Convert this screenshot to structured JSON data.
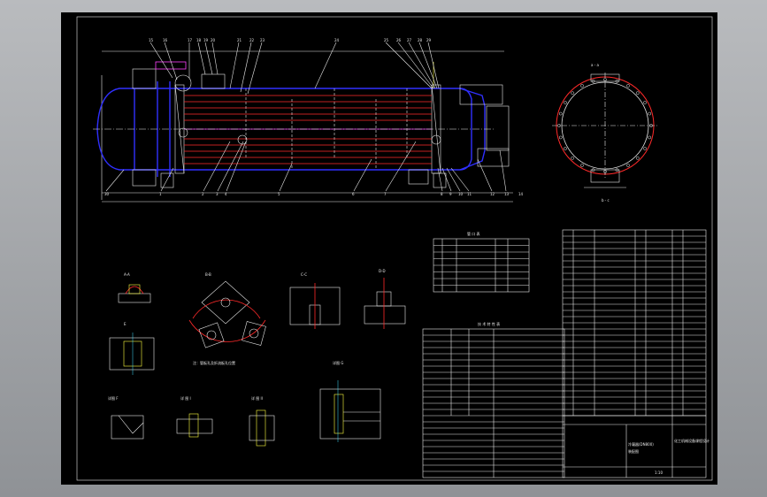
{
  "section_labels": {
    "nozzle_table": "管 口 表",
    "tech_spec": "技 术 特 性 表"
  },
  "views": {
    "side_view_label": "a - a",
    "top_label": "A - A",
    "detail_1": "详 图 I",
    "detail_2": "详 图 II"
  },
  "drawing_title": {
    "name_1": "冷凝器(DN800)",
    "name_2": "装配图",
    "company": "化工机械设备课程设计",
    "scale": "1:10"
  },
  "balloons": [
    "15",
    "16",
    "17",
    "18",
    "19",
    "20",
    "21",
    "22",
    "23",
    "24",
    "25",
    "26",
    "27",
    "28",
    "29",
    "30",
    "1",
    "2",
    "3",
    "4",
    "5",
    "6",
    "7",
    "8",
    "9",
    "10",
    "11",
    "12",
    "13",
    "14"
  ]
}
